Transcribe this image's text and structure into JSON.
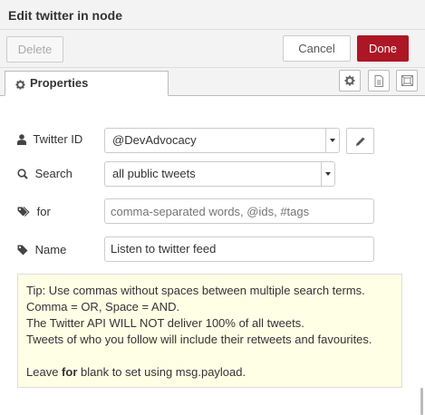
{
  "dialog": {
    "title": "Edit twitter in node"
  },
  "toolbar": {
    "delete_label": "Delete",
    "cancel_label": "Cancel",
    "done_label": "Done"
  },
  "tabs": [
    {
      "label": "Properties",
      "icon": "gear-icon",
      "active": true
    }
  ],
  "tab_icons": [
    "gear-icon",
    "document-icon",
    "frame-icon"
  ],
  "form": {
    "twitter_id": {
      "label": "Twitter ID",
      "icon": "user-icon",
      "value": "@DevAdvocacy"
    },
    "search": {
      "label": "Search",
      "icon": "search-icon",
      "value": "all public tweets"
    },
    "for": {
      "label": "for",
      "icon": "tags-icon",
      "value": "",
      "placeholder": "comma-separated words, @ids, #tags"
    },
    "name": {
      "label": "Name",
      "icon": "tag-icon",
      "value": "Listen to twitter feed"
    }
  },
  "tip": {
    "line1": "Tip: Use commas without spaces between multiple search terms.",
    "line2": "Comma = OR, Space = AND.",
    "line3": "The Twitter API WILL NOT deliver 100% of all tweets.",
    "line4": "Tweets of who you follow will include their retweets and favourites.",
    "line5_prefix": "Leave ",
    "line5_bold": "for",
    "line5_suffix": " blank to set using msg.payload."
  },
  "colors": {
    "done_button": "#ad1625",
    "tip_background": "#ffffe6"
  }
}
